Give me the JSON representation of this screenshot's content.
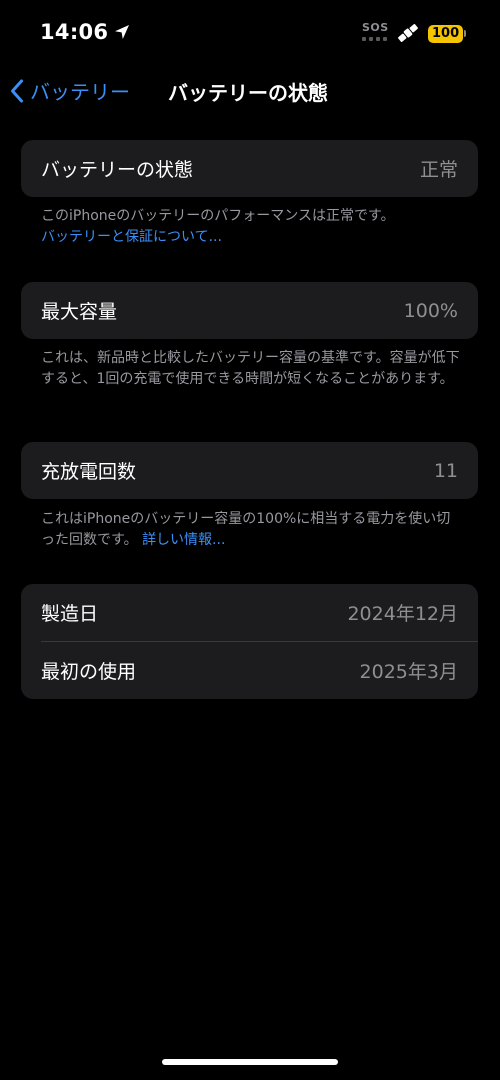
{
  "status_bar": {
    "time": "14:06",
    "sos": "SOS",
    "battery_level": "100",
    "battery_color": "#f5c400"
  },
  "nav": {
    "back_label": "バッテリー",
    "title": "バッテリーの状態"
  },
  "accent_color": "#3b8ff6",
  "health": {
    "label": "バッテリーの状態",
    "value": "正常",
    "footnote": "このiPhoneのバッテリーのパフォーマンスは正常です。",
    "link": "バッテリーと保証について..."
  },
  "capacity": {
    "label": "最大容量",
    "value": "100%",
    "footnote": "これは、新品時と比較したバッテリー容量の基準です。容量が低下すると、1回の充電で使用できる時間が短くなることがあります。"
  },
  "cycles": {
    "label": "充放電回数",
    "value": "11",
    "footnote": "これはiPhoneのバッテリー容量の100%に相当する電力を使い切った回数です。",
    "link": "詳しい情報..."
  },
  "dates": {
    "manufacture_label": "製造日",
    "manufacture_value": "2024年12月",
    "first_use_label": "最初の使用",
    "first_use_value": "2025年3月"
  },
  "icons": {
    "location": "location-arrow-icon",
    "satellite": "satellite-icon",
    "back": "chevron-left-icon"
  }
}
